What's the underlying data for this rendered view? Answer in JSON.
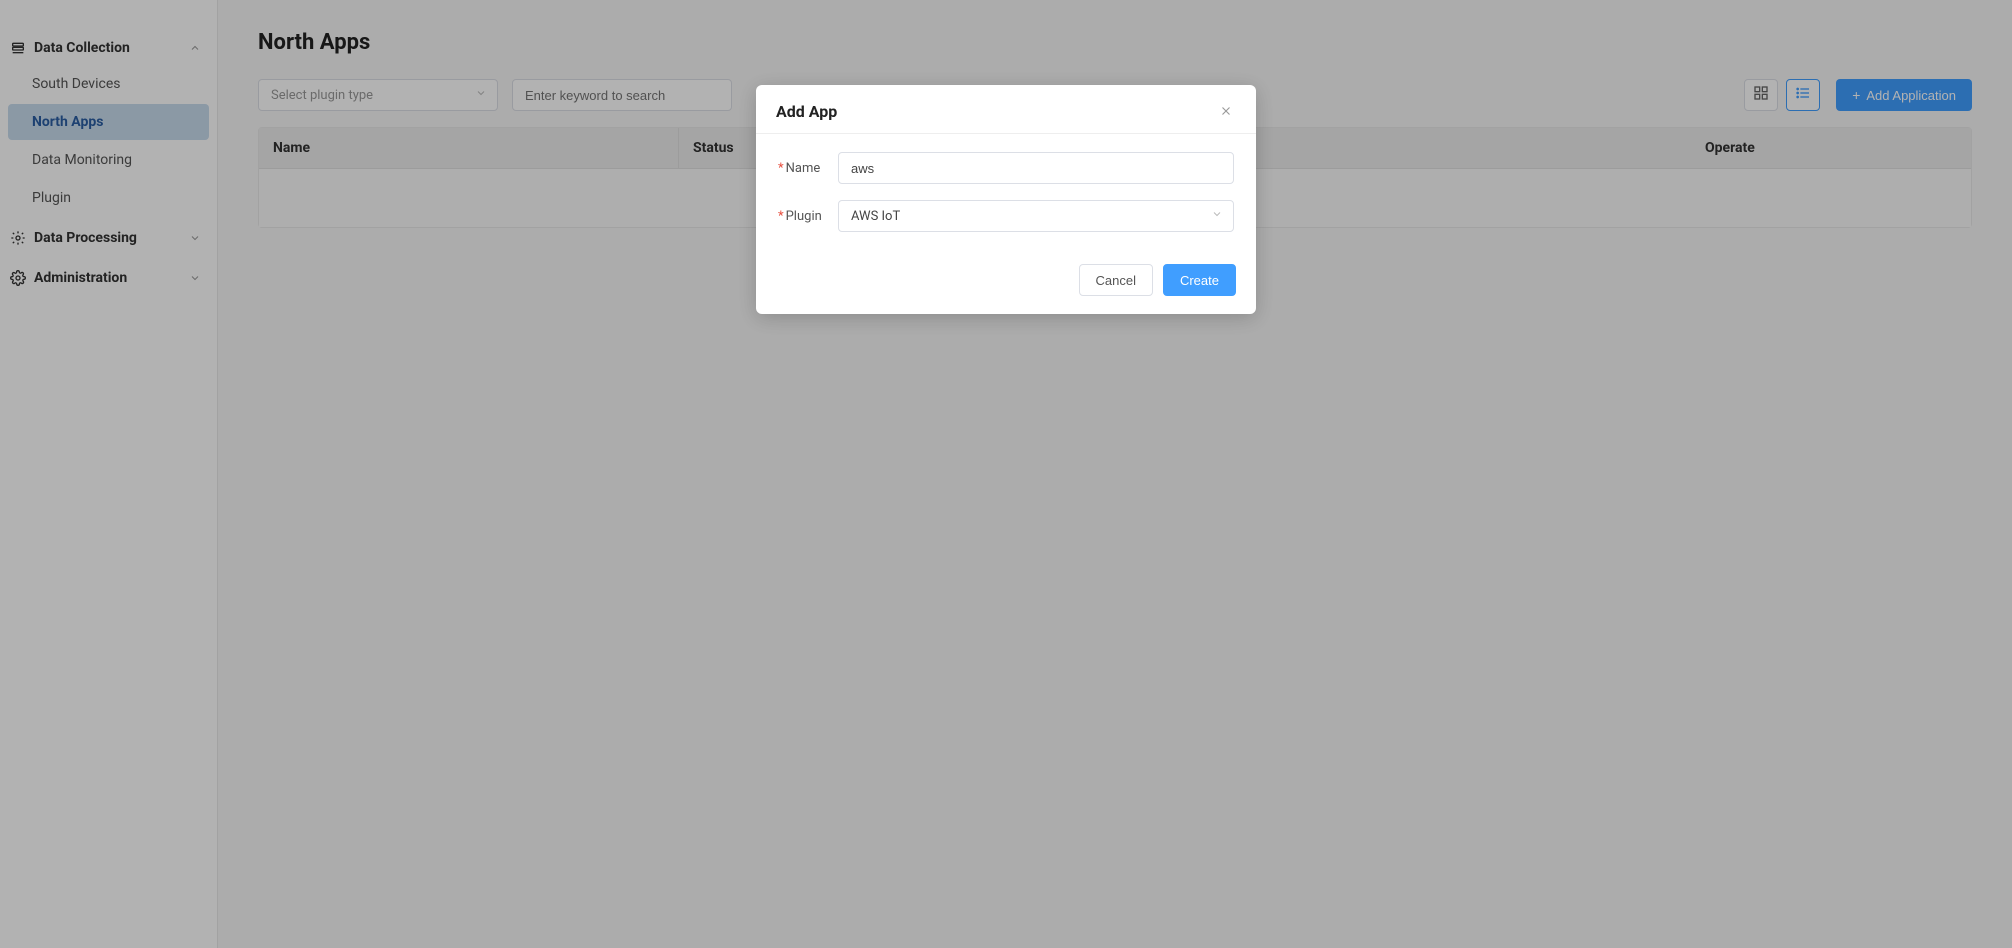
{
  "sidebar": {
    "sections": [
      {
        "id": "data-collection",
        "label": "Data Collection",
        "expanded": true,
        "items": [
          {
            "id": "south-devices",
            "label": "South Devices",
            "active": false
          },
          {
            "id": "north-apps",
            "label": "North Apps",
            "active": true
          },
          {
            "id": "data-monitoring",
            "label": "Data Monitoring",
            "active": false
          },
          {
            "id": "plugin",
            "label": "Plugin",
            "active": false
          }
        ]
      },
      {
        "id": "data-processing",
        "label": "Data Processing",
        "expanded": false,
        "items": []
      },
      {
        "id": "administration",
        "label": "Administration",
        "expanded": false,
        "items": []
      }
    ]
  },
  "page": {
    "title": "North Apps"
  },
  "toolbar": {
    "plugin_select_placeholder": "Select plugin type",
    "search_placeholder": "Enter keyword to search",
    "add_button_label": "Add Application"
  },
  "table": {
    "columns": {
      "name": "Name",
      "status": "Status",
      "operate": "Operate"
    },
    "rows": []
  },
  "modal": {
    "title": "Add App",
    "fields": {
      "name_label": "Name",
      "name_value": "aws",
      "plugin_label": "Plugin",
      "plugin_value": "AWS IoT"
    },
    "buttons": {
      "cancel": "Cancel",
      "create": "Create"
    }
  },
  "icons": {
    "database": "database-icon",
    "processing": "processing-icon",
    "admin": "gear-icon",
    "chevron_down": "chevron-down-icon",
    "chevron_up": "chevron-up-icon",
    "grid": "grid-view-icon",
    "list": "list-view-icon",
    "plus": "plus-icon",
    "close": "close-icon"
  }
}
